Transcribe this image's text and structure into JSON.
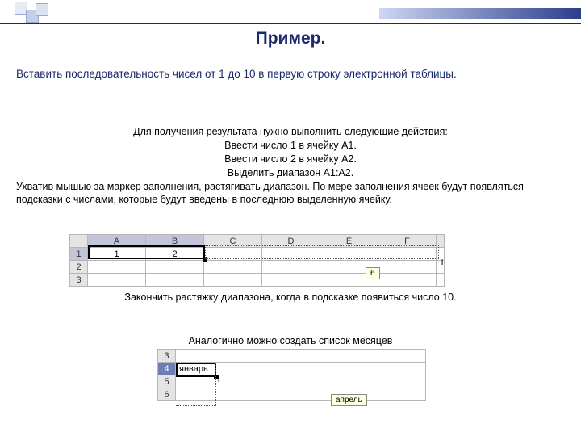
{
  "title": "Пример.",
  "subtitle": "Вставить последовательность чисел от 1 до 10 в первую строку электронной таблицы.",
  "body1": {
    "l1": "Для получения результата нужно выполнить следующие действия:",
    "l2": "Ввести число 1 в ячейку A1.",
    "l3": "Ввести число 2 в ячейку A2.",
    "l4": "Выделить диапазон A1:A2.",
    "l5": "Ухватив мышью за маркер заполнения, растягивать диапазон. По мере заполнения ячеек будут появляться подсказки с числами, которые будут введены в последнюю выделенную ячейку."
  },
  "sheet1": {
    "cols": [
      "A",
      "B",
      "C",
      "D",
      "E",
      "F"
    ],
    "rows": [
      "1",
      "2",
      "3"
    ],
    "values": {
      "r1c1": "1",
      "r1c2": "2"
    },
    "tooltip": "6"
  },
  "body2": "Закончить растяжку диапазона, когда в подсказке появиться число 10.",
  "body3": "Аналогично можно создать список месяцев",
  "sheet2": {
    "rows": [
      "3",
      "4",
      "5",
      "6"
    ],
    "value": "январь",
    "tooltip": "апрель"
  }
}
